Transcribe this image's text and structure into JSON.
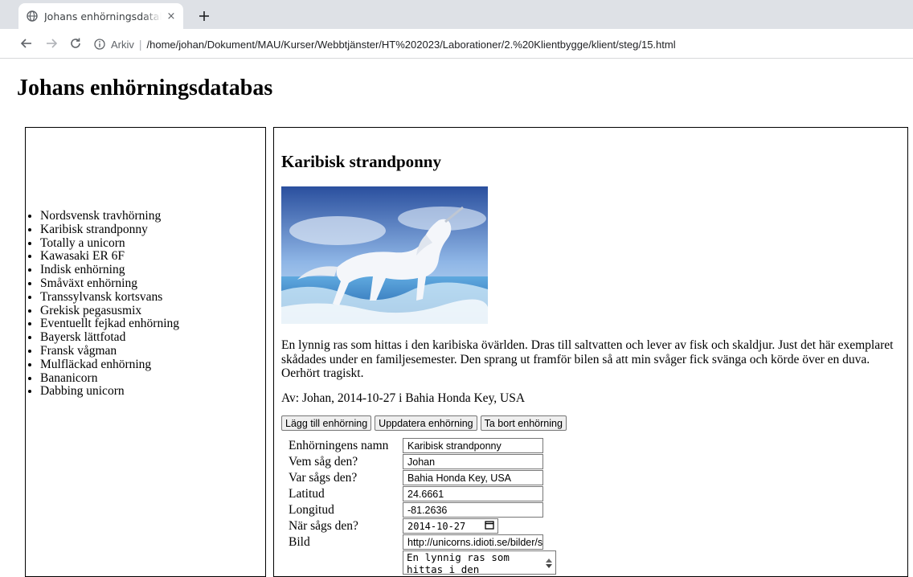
{
  "browser": {
    "tab_title": "Johans enhörningsdatabas",
    "tab_close": "×",
    "new_tab": "+",
    "address_prefix": "Arkiv",
    "address_separator": "|",
    "url": "/home/johan/Dokument/MAU/Kurser/Webbtjänster/HT%202023/Laborationer/2.%20Klientbygge/klient/steg/15.html"
  },
  "page": {
    "title": "Johans enhörningsdatabas"
  },
  "sidebar": {
    "items": [
      "Nordsvensk travhörning",
      "Karibisk strandponny",
      "Totally a unicorn",
      "Kawasaki ER 6F",
      "Indisk enhörning",
      "Småväxt enhörning",
      "Transsylvansk kortsvans",
      "Grekisk pegasusmix",
      "Eventuellt fejkad enhörning",
      "Bayersk lättfotad",
      "Fransk vågman",
      "Mulfläckad enhörning",
      "Bananicorn",
      "Dabbing unicorn"
    ]
  },
  "detail": {
    "title": "Karibisk strandponny",
    "description": "En lynnig ras som hittas i den karibiska övärlden. Dras till saltvatten och lever av fisk och skaldjur. Just det här exemplaret skådades under en familjesemester. Den sprang ut framför bilen så att min svåger fick svänga och körde över en duva. Oerhört tragiskt.",
    "byline": "Av: Johan, 2014-10-27 i Bahia Honda Key, USA"
  },
  "actions": {
    "add": "Lägg till enhörning",
    "update": "Uppdatera enhörning",
    "delete": "Ta bort enhörning"
  },
  "form": {
    "name_label": "Enhörningens namn",
    "name_value": "Karibisk strandponny",
    "who_label": "Vem såg den?",
    "who_value": "Johan",
    "where_label": "Var sågs den?",
    "where_value": "Bahia Honda Key, USA",
    "lat_label": "Latitud",
    "lat_value": "24.6661",
    "lon_label": "Longitud",
    "lon_value": "-81.2636",
    "when_label": "När sågs den?",
    "when_value": "2014-10-27",
    "image_label": "Bild",
    "image_value": "http://unicorns.idioti.se/bilder/s",
    "description_value": "En lynnig ras som hittas i den karibiska övärlden."
  },
  "icons": {
    "favicon": "globe-icon",
    "back": "arrow-left-icon",
    "forward": "arrow-right-icon",
    "reload": "reload-icon",
    "info": "info-icon",
    "calendar": "calendar-icon"
  },
  "colors": {
    "tabbar_bg": "#dee1e6",
    "text": "#000000",
    "field_border": "#767676",
    "button_bg": "#efefef"
  }
}
